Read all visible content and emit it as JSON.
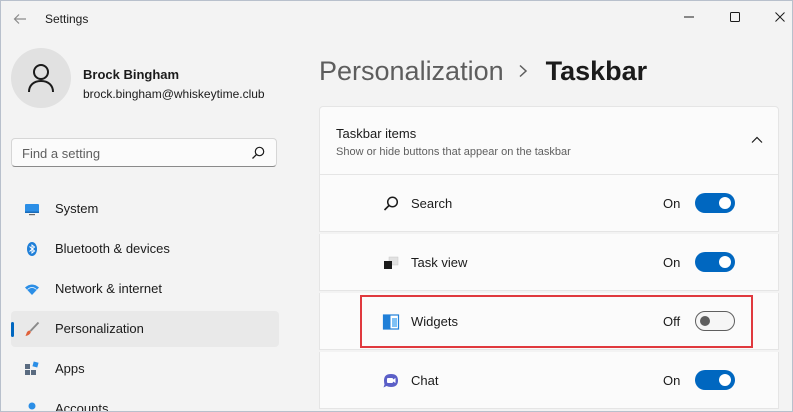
{
  "window": {
    "title": "Settings",
    "controls": [
      "minimize-icon",
      "maximize-icon",
      "close-icon"
    ]
  },
  "user": {
    "name": "Brock Bingham",
    "email": "brock.bingham@whiskeytime.club",
    "avatar_icon": "person-icon"
  },
  "search": {
    "placeholder": "Find a setting",
    "icon": "search-icon"
  },
  "sidebar": {
    "items": [
      {
        "label": "System",
        "icon": "monitor-icon",
        "selected": false
      },
      {
        "label": "Bluetooth & devices",
        "icon": "bluetooth-icon",
        "selected": false
      },
      {
        "label": "Network & internet",
        "icon": "wifi-icon",
        "selected": false
      },
      {
        "label": "Personalization",
        "icon": "brush-icon",
        "selected": true
      },
      {
        "label": "Apps",
        "icon": "apps-icon",
        "selected": false
      },
      {
        "label": "Accounts",
        "icon": "accounts-icon",
        "selected": false
      }
    ]
  },
  "breadcrumb": {
    "parent": "Personalization",
    "current": "Taskbar"
  },
  "section": {
    "title": "Taskbar items",
    "subtitle": "Show or hide buttons that appear on the taskbar",
    "expanded": true
  },
  "taskbar_items": [
    {
      "label": "Search",
      "icon": "search-icon",
      "state": "On",
      "on": true
    },
    {
      "label": "Task view",
      "icon": "task-view-icon",
      "state": "On",
      "on": true
    },
    {
      "label": "Widgets",
      "icon": "widgets-icon",
      "state": "Off",
      "on": false,
      "highlighted": true
    },
    {
      "label": "Chat",
      "icon": "chat-icon",
      "state": "On",
      "on": true
    }
  ],
  "colors": {
    "accent": "#0067c0",
    "highlight": "#e0393e",
    "window_bg": "#f3f3f3",
    "card_bg": "#fbfbfb"
  }
}
